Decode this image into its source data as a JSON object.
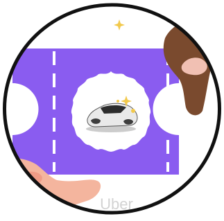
{
  "app": {
    "name": "Uber"
  },
  "icon": {
    "subject": "car-icon",
    "decor": "sparkle-icon",
    "ticket": "ticket-icon",
    "hands": "hand-icon"
  },
  "colors": {
    "background": "#ffffff",
    "ticket": "#8a5cf0",
    "ticket_stripe": "#ffffff",
    "badge": "#ffffff",
    "sparkle": "#f2c94c",
    "hand_right": "#7a4a2e",
    "hand_left": "#f4b59e",
    "border": "#111111",
    "label": "#d3d3d3"
  }
}
